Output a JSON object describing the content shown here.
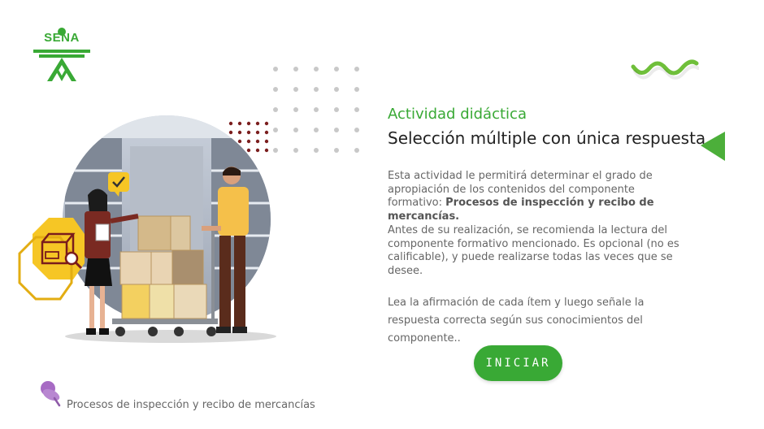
{
  "header": {
    "logo_text": "SENA"
  },
  "content": {
    "activity_type": "Actividad didáctica",
    "activity_title": "Selección múltiple con única respuesta",
    "paragraph_1_intro": "Esta actividad le permitirá determinar el grado de apropiación de los contenidos del componente formativo: ",
    "paragraph_1_bold": "Procesos de inspección y recibo de mercancías.",
    "paragraph_2": "Antes de su realización, se recomienda la lectura del componente formativo mencionado.  Es opcional (no es calificable), y puede realizarse todas las veces que se desee.",
    "paragraph_3": "Lea la afirmación de cada ítem y luego señale la respuesta correcta según sus conocimientos del componente..",
    "start_button_label": "INICIAR"
  },
  "footer": {
    "text": "Procesos de inspección y recibo de mercancías"
  },
  "icons": {
    "logo": "sena-logo",
    "decor_wave": "wave-icon",
    "decor_arrow": "triangle-left-icon",
    "warehouse_badge": "package-inspection-icon",
    "check_bubble": "checkmark-icon",
    "footer_pin": "pushpin-icon"
  },
  "colors": {
    "brand_green": "#39a935",
    "text_dark": "#222222",
    "text_body": "#666666",
    "badge_yellow": "#f6c625",
    "pin_purple": "#9b59b6"
  }
}
